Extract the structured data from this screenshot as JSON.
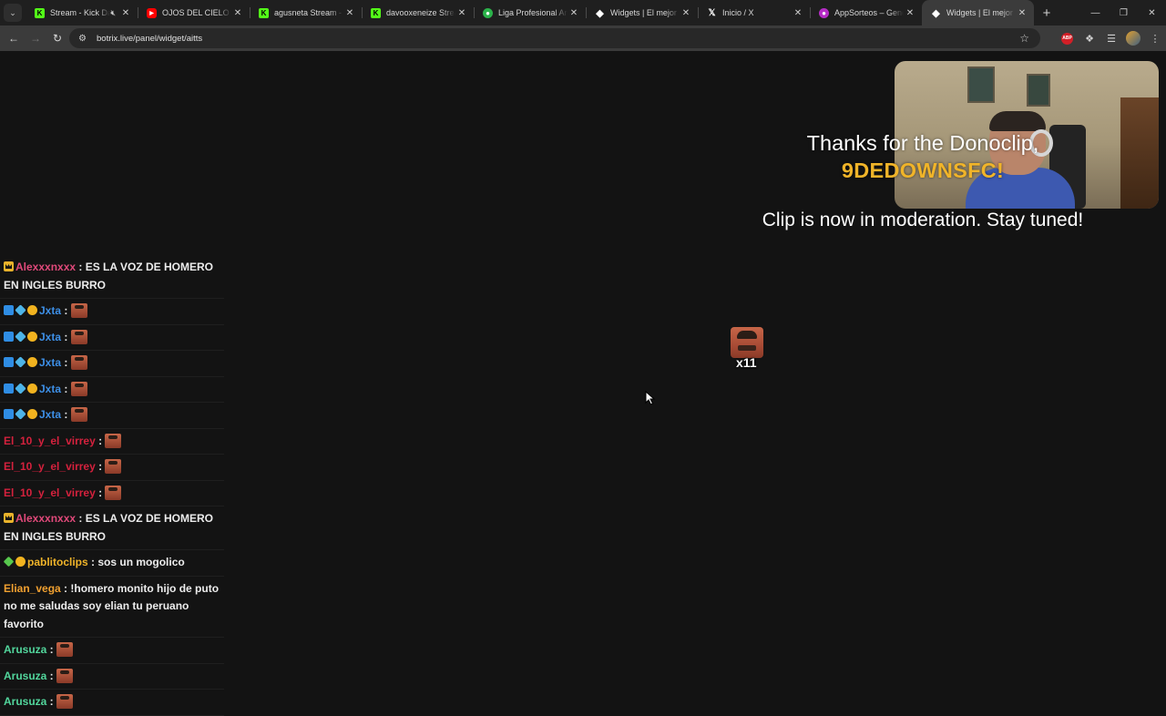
{
  "browser": {
    "tabs": [
      {
        "title": "Stream - Kick Da",
        "icon": "kick-icon",
        "muted": true
      },
      {
        "title": "OJOS DEL CIELO - Yo",
        "icon": "youtube-icon"
      },
      {
        "title": "agusneta Stream - W",
        "icon": "kick-icon"
      },
      {
        "title": "davooxeneize Stream",
        "icon": "kick-icon"
      },
      {
        "title": "Liga Profesional Arge",
        "icon": "liga-icon"
      },
      {
        "title": "Widgets | El mejor so",
        "icon": "diamond-icon"
      },
      {
        "title": "Inicio / X",
        "icon": "x-icon"
      },
      {
        "title": "AppSorteos – Genera",
        "icon": "appsorteos-icon"
      },
      {
        "title": "Widgets | El mejor so",
        "icon": "diamond-icon",
        "active": true
      }
    ],
    "url": "botrix.live/panel/widget/aitts"
  },
  "overlay": {
    "notification_title": "Thanks for the Donoclip,",
    "notification_user": "9DEDOWNSFC!",
    "notification_sub": "Clip is now in moderation. Stay tuned!",
    "emote_count": "x11"
  },
  "chat": [
    {
      "user": "Alexxxnxxx",
      "color": "#e0497a",
      "badges": [
        "crown"
      ],
      "text": "ES LA VOZ DE HOMERO EN INGLES BURRO"
    },
    {
      "user": "Jxta",
      "color": "#3d8fe6",
      "badges": [
        "x",
        "cube",
        "coin"
      ],
      "emote": true
    },
    {
      "user": "Jxta",
      "color": "#3d8fe6",
      "badges": [
        "x",
        "cube",
        "coin"
      ],
      "emote": true
    },
    {
      "user": "Jxta",
      "color": "#3d8fe6",
      "badges": [
        "x",
        "cube",
        "coin"
      ],
      "emote": true
    },
    {
      "user": "Jxta",
      "color": "#3d8fe6",
      "badges": [
        "x",
        "cube",
        "coin"
      ],
      "emote": true
    },
    {
      "user": "Jxta",
      "color": "#3d8fe6",
      "badges": [
        "x",
        "cube",
        "coin"
      ],
      "emote": true
    },
    {
      "user": "El_10_y_el_virrey",
      "color": "#d4213d",
      "badges": [],
      "emote": true
    },
    {
      "user": "El_10_y_el_virrey",
      "color": "#d4213d",
      "badges": [],
      "emote": true
    },
    {
      "user": "El_10_y_el_virrey",
      "color": "#d4213d",
      "badges": [],
      "emote": true
    },
    {
      "user": "Alexxxnxxx",
      "color": "#e0497a",
      "badges": [
        "crown"
      ],
      "text": "ES LA VOZ DE HOMERO EN INGLES BURRO"
    },
    {
      "user": "pablitoclips",
      "color": "#f0b429",
      "badges": [
        "gem",
        "coin"
      ],
      "text": "sos un mogolico"
    },
    {
      "user": "Elian_vega",
      "color": "#f0a030",
      "badges": [],
      "text": "!homero monito hijo de puto no me saludas soy elian tu peruano favorito"
    },
    {
      "user": "Arusuza",
      "color": "#52d69c",
      "badges": [],
      "emote": true
    },
    {
      "user": "Arusuza",
      "color": "#52d69c",
      "badges": [],
      "emote": true
    },
    {
      "user": "Arusuza",
      "color": "#52d69c",
      "badges": [],
      "emote": true
    }
  ]
}
